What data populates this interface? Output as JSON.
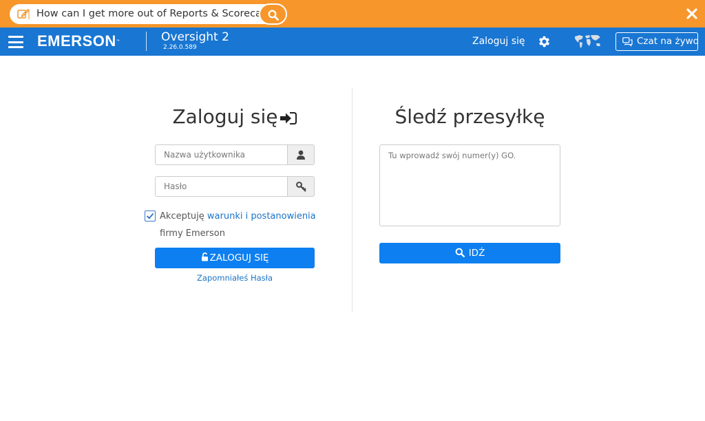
{
  "banner": {
    "search_text": "How can I get more out of Reports & Scorecards?",
    "icons": [
      "edit-icon",
      "search-icon",
      "close-icon"
    ],
    "bg_color": "#f7962a"
  },
  "header": {
    "brand": "EMERSON",
    "brand_tm": "™",
    "app_name": "Oversight 2",
    "version": "2.26.0.589",
    "login_link": "Zaloguj się",
    "chat_button": "Czat na żywo",
    "icons": [
      "menu-icon",
      "gear-icon",
      "world-map-icon",
      "chat-icon"
    ],
    "bg_color": "#1976d2"
  },
  "login": {
    "title": "Zaloguj się",
    "username_placeholder": "Nazwa użytkownika",
    "password_placeholder": "Hasło",
    "accept_prefix": "Akceptuję",
    "accept_link": "warunki i postanowienia",
    "accept_suffix": "firmy Emerson",
    "accept_checked": true,
    "submit_label": "ZALOGUJ SIĘ",
    "forgot_label": "Zapomniałeś Hasła"
  },
  "tracking": {
    "title": "Śledź przesyłkę",
    "placeholder": "Tu wprowadź swój numer(y) GO.",
    "go_label": "IDŹ"
  },
  "colors": {
    "primary_button": "#0d7ff0",
    "link": "#1a73c8"
  }
}
